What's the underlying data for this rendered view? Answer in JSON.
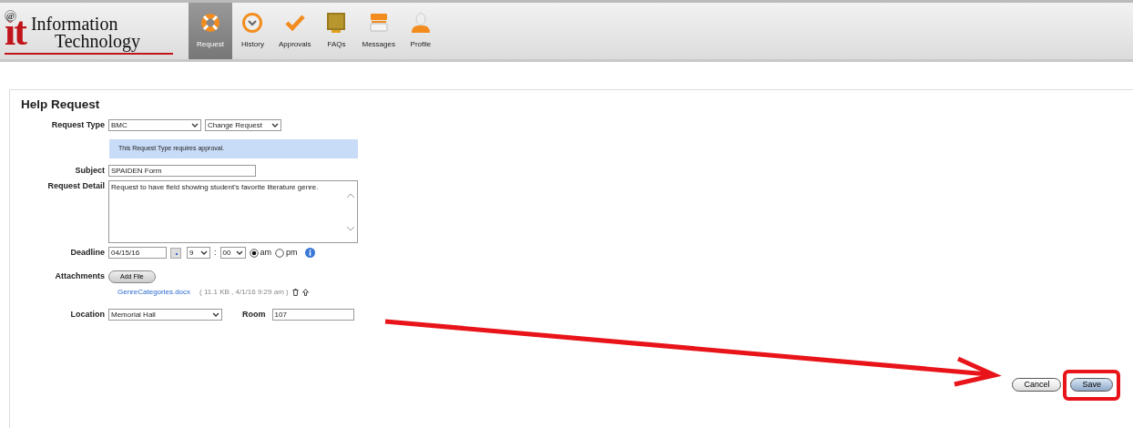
{
  "logo": {
    "mark": "it",
    "badge": "@",
    "line1": "Information",
    "line2": "Technology"
  },
  "nav": [
    {
      "label": "Request",
      "selected": true
    },
    {
      "label": "History",
      "selected": false
    },
    {
      "label": "Approvals",
      "selected": false
    },
    {
      "label": "FAQs",
      "selected": false
    },
    {
      "label": "Messages",
      "selected": false
    },
    {
      "label": "Profile",
      "selected": false
    }
  ],
  "form": {
    "title": "Help Request",
    "request_type": {
      "label": "Request Type",
      "value": "BMC",
      "subtype": "Change Request"
    },
    "notice": "This Request Type requires approval.",
    "subject": {
      "label": "Subject",
      "value": "SPAIDEN Form"
    },
    "detail": {
      "label": "Request Detail",
      "value": "Request to have field showing student's favorite literature genre."
    },
    "deadline": {
      "label": "Deadline",
      "date": "04/15/16",
      "hour": "9",
      "separator": ":",
      "minute": "00",
      "periods": [
        {
          "label": "am",
          "selected": true
        },
        {
          "label": "pm",
          "selected": false
        }
      ]
    },
    "attachments": {
      "label": "Attachments",
      "button": "Add File",
      "files": [
        {
          "name": "GenreCategories.docx",
          "info": "( 11.1 KB , 4/1/16 9:29 am )"
        }
      ]
    },
    "location": {
      "label": "Location",
      "value": "Memorial Hall"
    },
    "room": {
      "label": "Room",
      "value": "107"
    }
  },
  "buttons": [
    {
      "label": "Cancel",
      "kind": "secondary",
      "highlighted": false
    },
    {
      "label": "Save",
      "kind": "primary",
      "highlighted": true
    }
  ]
}
